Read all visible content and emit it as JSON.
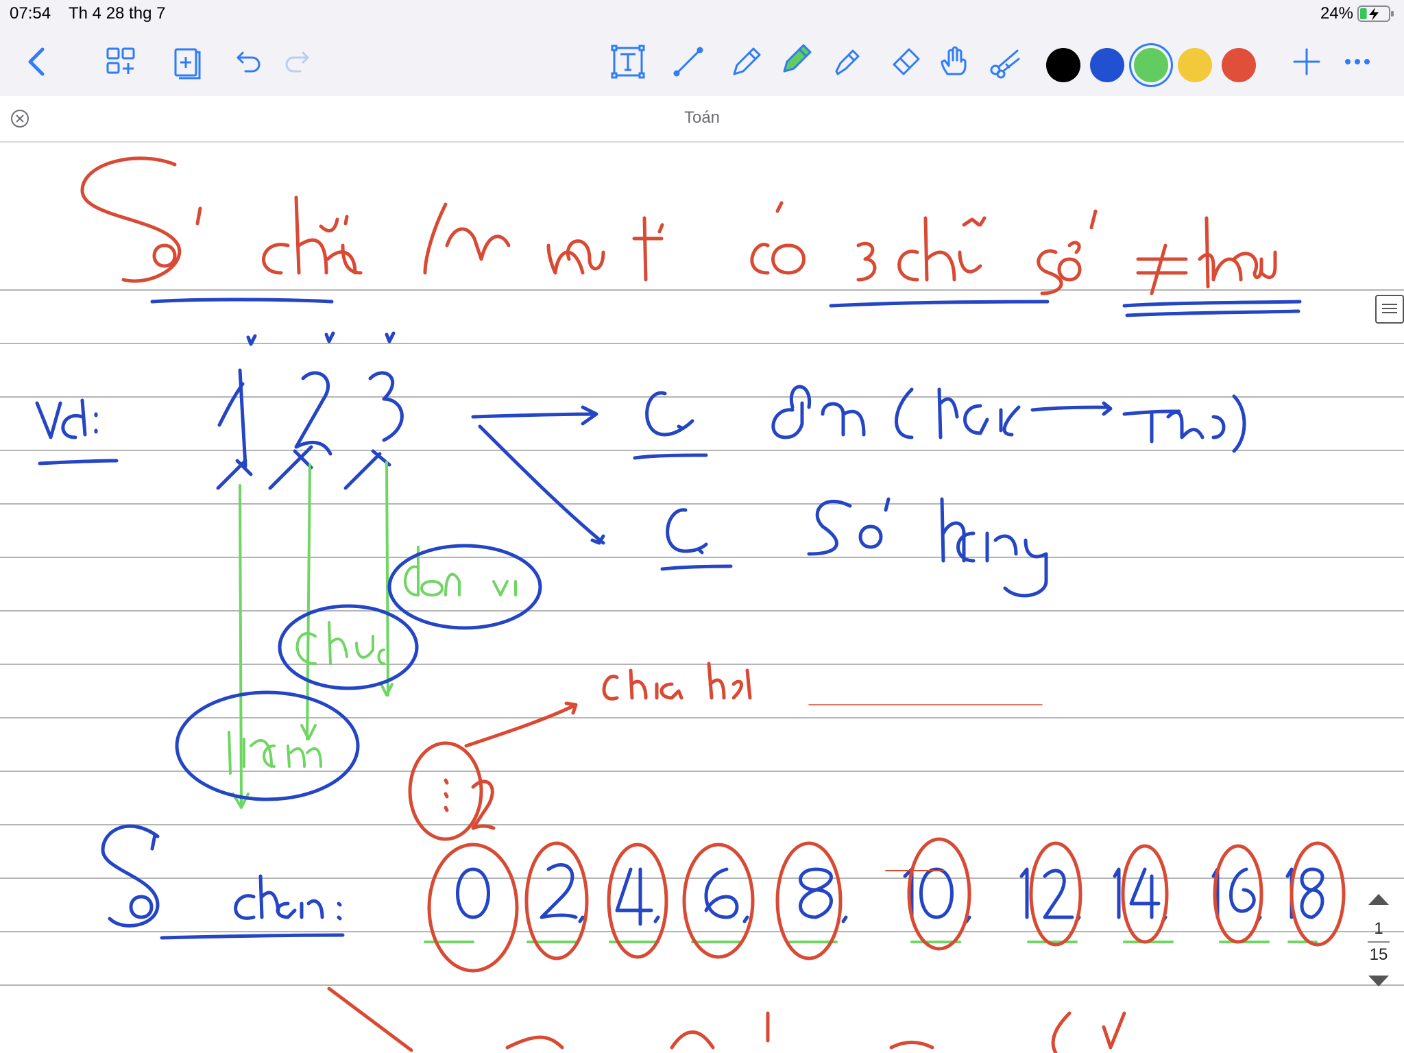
{
  "status_bar": {
    "time": "07:54",
    "date": "Th 4 28 thg 7",
    "battery_percent": "24%",
    "battery_level": 0.24,
    "charging": true
  },
  "toolbar": {
    "tools": [
      "back-icon",
      "thumbnails-icon",
      "add-page-icon",
      "undo-icon",
      "redo-icon",
      "text-box-icon",
      "line-icon",
      "pencil-icon",
      "pen-icon",
      "highlighter-icon",
      "eraser-icon",
      "hand-icon",
      "scissors-icon"
    ],
    "selected_tool": "pen-icon",
    "colors": [
      "#000000",
      "#2150d0",
      "#62cc60",
      "#f2c93a",
      "#df4f3a"
    ],
    "selected_color": "#62cc60",
    "extra": [
      "plus-icon",
      "more-icon"
    ]
  },
  "document": {
    "title": "Toán"
  },
  "pager": {
    "current": "1",
    "total": "15"
  },
  "handwriting": {
    "ink_colors": {
      "red": "#d84a33",
      "blue": "#2445c4",
      "green": "#6fd563"
    }
  }
}
